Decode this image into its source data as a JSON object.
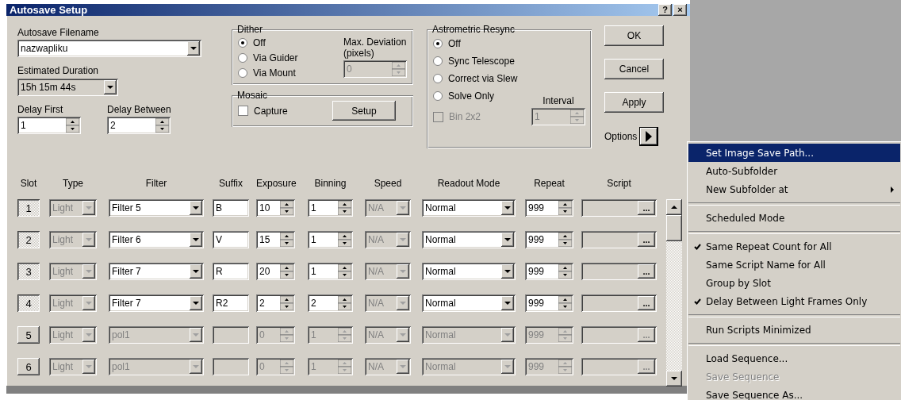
{
  "window": {
    "title": "Autosave Setup",
    "title_buttons": [
      "?",
      "×"
    ]
  },
  "filename": {
    "label": "Autosave Filename",
    "value": "nazwapliku"
  },
  "duration": {
    "label": "Estimated Duration",
    "value": "15h 15m 44s"
  },
  "delay_first": {
    "label": "Delay First",
    "value": "1"
  },
  "delay_between": {
    "label": "Delay Between",
    "value": "2"
  },
  "dither": {
    "title": "Dither",
    "options": [
      {
        "label": "Off",
        "selected": true
      },
      {
        "label": "Via Guider",
        "selected": false
      },
      {
        "label": "Via Mount",
        "selected": false
      }
    ],
    "max_deviation": {
      "label": "Max. Deviation (pixels)",
      "value": "0",
      "disabled": true
    }
  },
  "mosaic": {
    "title": "Mosaic",
    "capture": {
      "label": "Capture",
      "checked": false
    },
    "setup_button": "Setup"
  },
  "astrometric": {
    "title": "Astrometric Resync",
    "options": [
      {
        "label": "Off",
        "selected": true
      },
      {
        "label": "Sync Telescope",
        "selected": false
      },
      {
        "label": "Correct via Slew",
        "selected": false
      },
      {
        "label": "Solve Only",
        "selected": false
      }
    ],
    "bin": {
      "label": "Bin 2x2",
      "checked": false,
      "disabled": true
    },
    "interval": {
      "label": "Interval",
      "value": "1",
      "disabled": true
    }
  },
  "buttons": [
    "OK",
    "Cancel",
    "Apply"
  ],
  "options_label": "Options",
  "table": {
    "columns": [
      "Slot",
      "Type",
      "Filter",
      "Suffix",
      "Exposure",
      "Binning",
      "Speed",
      "Readout Mode",
      "Repeat",
      "Script"
    ],
    "rows": [
      {
        "slot": "1",
        "selected": true,
        "enabled": true,
        "type": "Light",
        "type_disabled": true,
        "filter": "Filter 5",
        "suffix": "B",
        "exposure": "10",
        "binning": "1",
        "speed": "N/A",
        "speed_disabled": true,
        "readout": "Normal",
        "repeat": "999",
        "script_button": "..."
      },
      {
        "slot": "2",
        "selected": true,
        "enabled": true,
        "type": "Light",
        "type_disabled": true,
        "filter": "Filter 6",
        "suffix": "V",
        "exposure": "15",
        "binning": "1",
        "speed": "N/A",
        "speed_disabled": true,
        "readout": "Normal",
        "repeat": "999",
        "script_button": "..."
      },
      {
        "slot": "3",
        "selected": true,
        "enabled": true,
        "type": "Light",
        "type_disabled": true,
        "filter": "Filter 7",
        "suffix": "R",
        "exposure": "20",
        "binning": "1",
        "speed": "N/A",
        "speed_disabled": true,
        "readout": "Normal",
        "repeat": "999",
        "script_button": "..."
      },
      {
        "slot": "4",
        "selected": true,
        "enabled": true,
        "type": "Light",
        "type_disabled": true,
        "filter": "Filter 7",
        "suffix": "R2",
        "exposure": "2",
        "binning": "2",
        "speed": "N/A",
        "speed_disabled": true,
        "readout": "Normal",
        "repeat": "999",
        "script_button": "..."
      },
      {
        "slot": "5",
        "selected": false,
        "enabled": false,
        "type": "Light",
        "type_disabled": true,
        "filter": "pol1",
        "exposure": "0",
        "binning": "1",
        "speed": "N/A",
        "speed_disabled": true,
        "readout": "Normal",
        "repeat": "999",
        "script_button": "..."
      },
      {
        "slot": "6",
        "selected": false,
        "enabled": false,
        "type": "Light",
        "type_disabled": true,
        "filter": "pol1",
        "exposure": "0",
        "binning": "1",
        "speed": "N/A",
        "speed_disabled": true,
        "readout": "Normal",
        "repeat": "999",
        "script_button": "..."
      }
    ]
  },
  "menu": {
    "items": [
      {
        "kind": "item",
        "label": "Set Image Save Path...",
        "selected": true,
        "checked": false,
        "disabled": false
      },
      {
        "kind": "item",
        "label": "Auto-Subfolder",
        "selected": false,
        "checked": false,
        "disabled": false
      },
      {
        "kind": "submenu",
        "label": "New Subfolder at",
        "selected": false,
        "checked": false,
        "disabled": false
      },
      {
        "kind": "separator"
      },
      {
        "kind": "item",
        "label": "Scheduled Mode",
        "selected": false,
        "checked": false,
        "disabled": false
      },
      {
        "kind": "separator"
      },
      {
        "kind": "item",
        "label": "Same Repeat Count for All",
        "selected": false,
        "checked": true,
        "disabled": false
      },
      {
        "kind": "item",
        "label": "Same Script Name for All",
        "selected": false,
        "checked": false,
        "disabled": false
      },
      {
        "kind": "item",
        "label": "Group by Slot",
        "selected": false,
        "checked": false,
        "disabled": false
      },
      {
        "kind": "item",
        "label": "Delay Between Light Frames Only",
        "selected": false,
        "checked": true,
        "disabled": false
      },
      {
        "kind": "separator"
      },
      {
        "kind": "item",
        "label": "Run Scripts Minimized",
        "selected": false,
        "checked": false,
        "disabled": false
      },
      {
        "kind": "separator"
      },
      {
        "kind": "item",
        "label": "Load Sequence...",
        "selected": false,
        "checked": false,
        "disabled": false
      },
      {
        "kind": "item",
        "label": "Save Sequence",
        "selected": false,
        "checked": false,
        "disabled": true
      },
      {
        "kind": "item",
        "label": "Save Sequence As...",
        "selected": false,
        "checked": false,
        "disabled": false
      }
    ]
  }
}
